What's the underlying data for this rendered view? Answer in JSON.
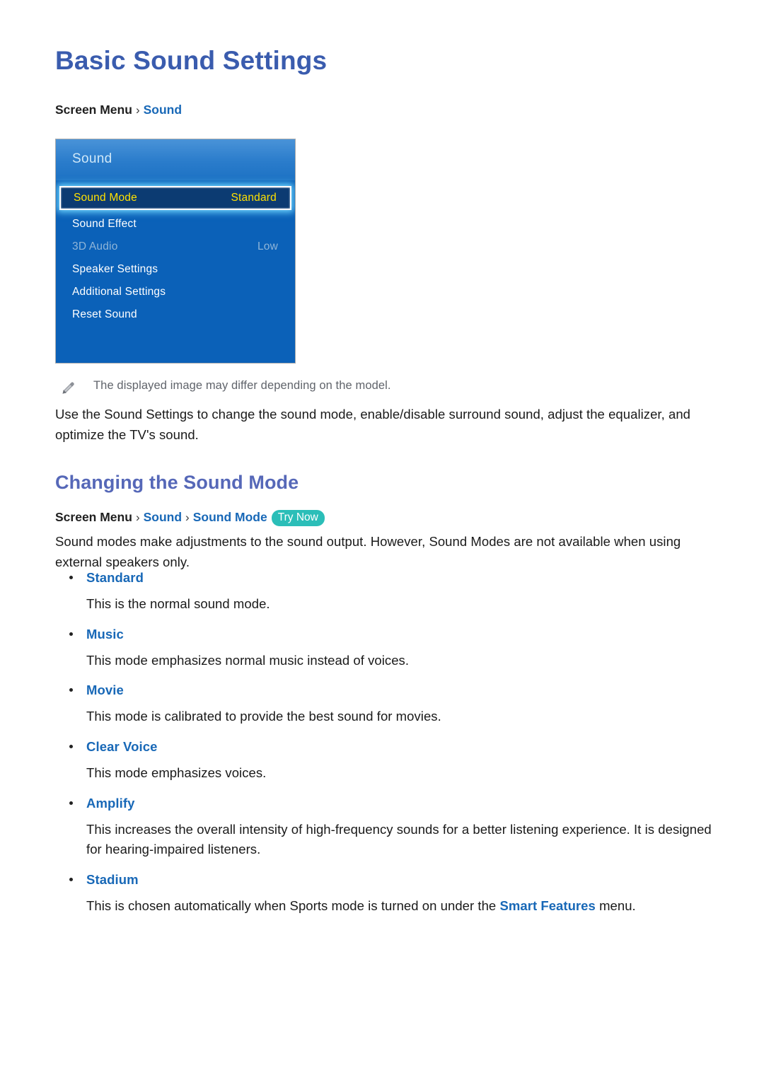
{
  "page": {
    "title": "Basic Sound Settings"
  },
  "breadcrumb_top": {
    "root": "Screen Menu",
    "separator": "›",
    "item1": "Sound"
  },
  "tv_menu": {
    "panel_title": "Sound",
    "rows": [
      {
        "label": "Sound Mode",
        "value": "Standard",
        "state": "selected"
      },
      {
        "label": "Sound Effect",
        "value": "",
        "state": "normal"
      },
      {
        "label": "3D Audio",
        "value": "Low",
        "state": "disabled"
      },
      {
        "label": "Speaker Settings",
        "value": "",
        "state": "normal"
      },
      {
        "label": "Additional Settings",
        "value": "",
        "state": "normal"
      },
      {
        "label": "Reset Sound",
        "value": "",
        "state": "normal"
      }
    ],
    "colors": {
      "panel_body": "#0b61b8",
      "header_top": "#4a93d8",
      "selected_bg": "#0c3b72",
      "selected_text": "#ffe000",
      "glow": "#6fd6ff",
      "disabled_text": "#8fb5d8"
    }
  },
  "note": {
    "icon": "pencil-icon",
    "text": "The displayed image may differ depending on the model."
  },
  "intro_paragraph": "Use the Sound Settings to change the sound mode, enable/disable surround sound, adjust the equalizer, and optimize the TV's sound.",
  "section": {
    "heading": "Changing the Sound Mode"
  },
  "breadcrumb_section": {
    "root": "Screen Menu",
    "separator": "›",
    "item1": "Sound",
    "item2": "Sound Mode",
    "badge": "Try Now",
    "badge_color": "#2bbeb8"
  },
  "modes_paragraph": "Sound modes make adjustments to the sound output. However, Sound Modes are not available when using external speakers only.",
  "modes": [
    {
      "term": "Standard",
      "desc": "This is the normal sound mode."
    },
    {
      "term": "Music",
      "desc": "This mode emphasizes normal music instead of voices."
    },
    {
      "term": "Movie",
      "desc": "This mode is calibrated to provide the best sound for movies."
    },
    {
      "term": "Clear Voice",
      "desc": "This mode emphasizes voices."
    },
    {
      "term": "Amplify",
      "desc": "This increases the overall intensity of high-frequency sounds for a better listening experience. It is designed for hearing-impaired listeners."
    },
    {
      "term": "Stadium",
      "desc_pre": "This is chosen automatically when Sports mode is turned on under the ",
      "desc_link": "Smart Features",
      "desc_post": " menu."
    }
  ],
  "theme": {
    "title_color": "#3a5cae",
    "heading_color": "#5668b8",
    "link_color": "#1868b7",
    "body_color": "#1a1a1a",
    "note_color": "#60646b"
  }
}
